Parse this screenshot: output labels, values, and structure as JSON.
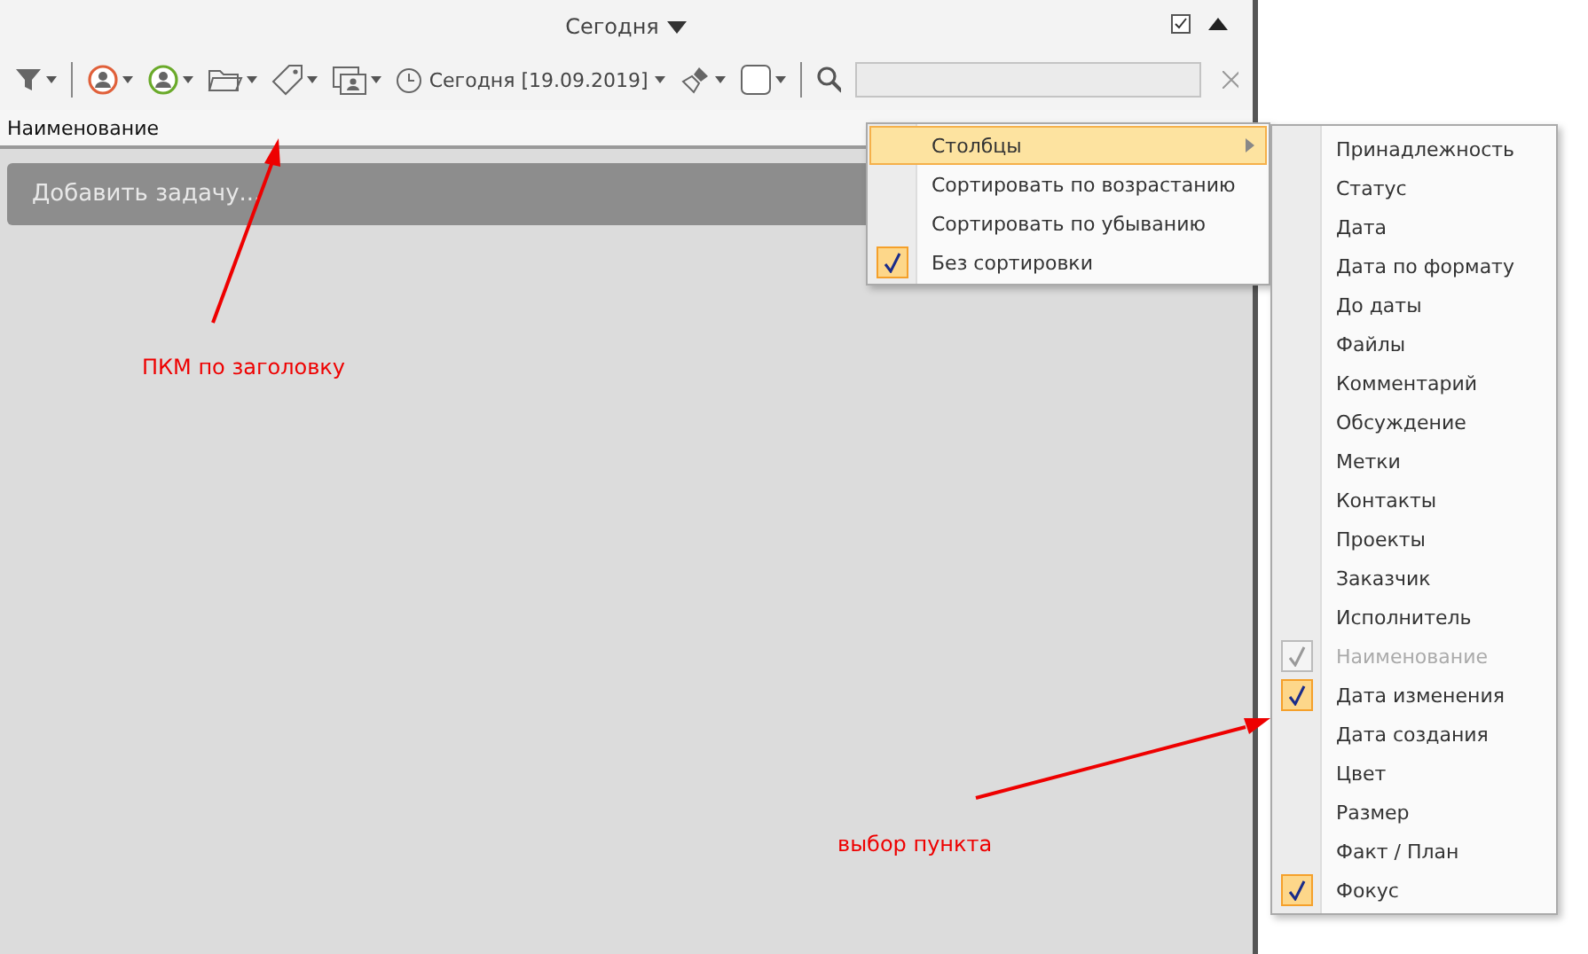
{
  "title": "Сегодня",
  "toolbar": {
    "date_label": "Сегодня [19.09.2019]"
  },
  "table": {
    "columns": [
      "Наименование"
    ]
  },
  "add_task": {
    "placeholder": "Добавить задачу..."
  },
  "context_menu": [
    {
      "kind": "submenu",
      "label": "Столбцы",
      "checked": false,
      "highlighted": true
    },
    {
      "kind": "item",
      "label": "Сортировать по возрастанию",
      "checked": false,
      "highlighted": false
    },
    {
      "kind": "item",
      "label": "Сортировать по убыванию",
      "checked": false,
      "highlighted": false
    },
    {
      "kind": "item",
      "label": "Без сортировки",
      "checked": true,
      "highlighted": false
    }
  ],
  "columns_menu": [
    {
      "label": "Принадлежность",
      "checked": false,
      "disabled": false
    },
    {
      "label": "Статус",
      "checked": false,
      "disabled": false
    },
    {
      "label": "Дата",
      "checked": false,
      "disabled": false
    },
    {
      "label": "Дата по формату",
      "checked": false,
      "disabled": false
    },
    {
      "label": "До даты",
      "checked": false,
      "disabled": false
    },
    {
      "label": "Файлы",
      "checked": false,
      "disabled": false
    },
    {
      "label": "Комментарий",
      "checked": false,
      "disabled": false
    },
    {
      "label": "Обсуждение",
      "checked": false,
      "disabled": false
    },
    {
      "label": "Метки",
      "checked": false,
      "disabled": false
    },
    {
      "label": "Контакты",
      "checked": false,
      "disabled": false
    },
    {
      "label": "Проекты",
      "checked": false,
      "disabled": false
    },
    {
      "label": "Заказчик",
      "checked": false,
      "disabled": false
    },
    {
      "label": "Исполнитель",
      "checked": false,
      "disabled": false
    },
    {
      "label": "Наименование",
      "checked": true,
      "disabled": true
    },
    {
      "label": "Дата изменения",
      "checked": true,
      "disabled": false
    },
    {
      "label": "Дата создания",
      "checked": false,
      "disabled": false
    },
    {
      "label": "Цвет",
      "checked": false,
      "disabled": false
    },
    {
      "label": "Размер",
      "checked": false,
      "disabled": false
    },
    {
      "label": "Факт / План",
      "checked": false,
      "disabled": false
    },
    {
      "label": "Фокус",
      "checked": true,
      "disabled": false
    }
  ],
  "annotations": [
    "ПКМ по заголовку",
    "выбор пункта"
  ]
}
